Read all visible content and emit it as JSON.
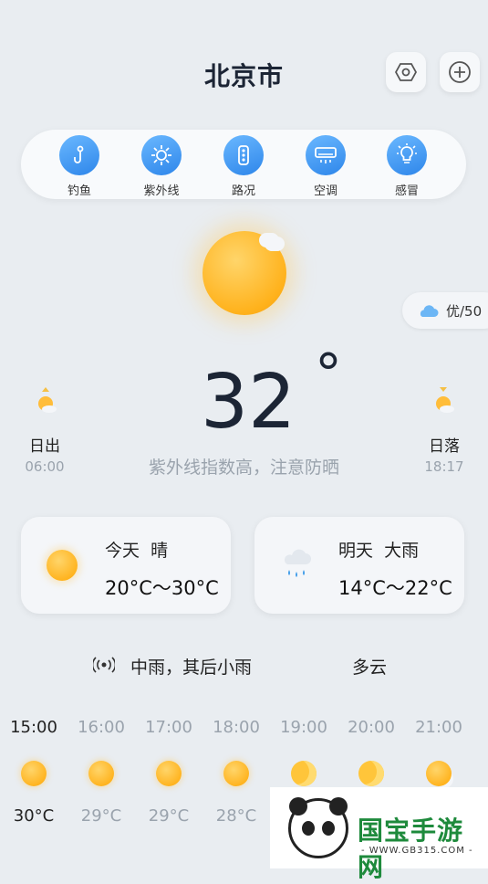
{
  "header": {
    "city": "北京市",
    "settings_icon": "hexagon-settings-icon",
    "add_icon": "plus-circle-icon"
  },
  "tools": [
    {
      "label": "钓鱼",
      "icon": "fishing-hook-icon"
    },
    {
      "label": "紫外线",
      "icon": "uv-sun-icon"
    },
    {
      "label": "路况",
      "icon": "traffic-light-icon"
    },
    {
      "label": "空调",
      "icon": "air-conditioner-icon"
    },
    {
      "label": "感冒",
      "icon": "lightbulb-icon"
    }
  ],
  "current": {
    "weather_icon": "sun-icon",
    "aqi": "优/50",
    "temperature": "32",
    "degree_symbol": "°",
    "tip": "紫外线指数高，注意防晒",
    "sunrise_label": "日出",
    "sunrise_time": "06:00",
    "sunset_label": "日落",
    "sunset_time": "18:17"
  },
  "days": [
    {
      "day": "今天",
      "cond": "晴",
      "range": "20°C～30°C",
      "icon": "sun-icon"
    },
    {
      "day": "明天",
      "cond": "大雨",
      "range": "14°C～22°C",
      "icon": "rain-cloud-icon"
    }
  ],
  "ticker": {
    "icon": "broadcast-icon",
    "text1": "中雨，其后小雨",
    "text2": "多云"
  },
  "hourly": [
    {
      "time": "15:00",
      "temp": "30°C",
      "icon": "sun-icon"
    },
    {
      "time": "16:00",
      "temp": "29°C",
      "icon": "sun-icon"
    },
    {
      "time": "17:00",
      "temp": "29°C",
      "icon": "sun-icon"
    },
    {
      "time": "18:00",
      "temp": "28°C",
      "icon": "sun-icon"
    },
    {
      "time": "19:00",
      "temp": "",
      "icon": "moon-icon"
    },
    {
      "time": "20:00",
      "temp": "",
      "icon": "moon-icon"
    },
    {
      "time": "21:00",
      "temp": "",
      "icon": "cloudy-sun-icon"
    }
  ],
  "watermark": {
    "text": "国宝手游网",
    "url": "- WWW.GB315.COM -"
  }
}
